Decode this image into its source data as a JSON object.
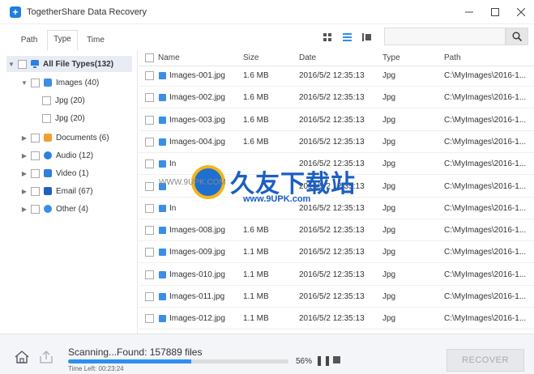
{
  "window": {
    "title": "TogetherShare Data Recovery",
    "controls": [
      "minimize",
      "maximize",
      "close"
    ]
  },
  "tabs": [
    {
      "label": "Path",
      "active": false
    },
    {
      "label": "Type",
      "active": true
    },
    {
      "label": "Time",
      "active": false
    }
  ],
  "search": {
    "placeholder": ""
  },
  "tree": {
    "root": {
      "label": "All File Types(132)"
    },
    "items": [
      {
        "label": "Images (40)",
        "expanded": true,
        "color": "#3a8ee6"
      },
      {
        "label": "Jpg (20)",
        "child": true
      },
      {
        "label": "Jpg (20)",
        "child": true
      },
      {
        "label": "Documents (6)",
        "color": "#f0a030"
      },
      {
        "label": "Audio (12)",
        "color": "#2d7fe0"
      },
      {
        "label": "Video (1)",
        "color": "#2d7fe0"
      },
      {
        "label": "Email (67)",
        "color": "#2060c0"
      },
      {
        "label": "Other (4)",
        "color": "#3a8ee6"
      }
    ]
  },
  "list": {
    "headers": {
      "name": "Name",
      "size": "Size",
      "date": "Date",
      "type": "Type",
      "path": "Path"
    },
    "rows": [
      {
        "name": "Images-001.jpg",
        "size": "1.6 MB",
        "date": "2016/5/2 12:35:13",
        "type": "Jpg",
        "path": "C:\\MyImages\\2016-1..."
      },
      {
        "name": "Images-002.jpg",
        "size": "1.6 MB",
        "date": "2016/5/2 12:35:13",
        "type": "Jpg",
        "path": "C:\\MyImages\\2016-1..."
      },
      {
        "name": "Images-003.jpg",
        "size": "1.6 MB",
        "date": "2016/5/2 12:35:13",
        "type": "Jpg",
        "path": "C:\\MyImages\\2016-1..."
      },
      {
        "name": "Images-004.jpg",
        "size": "1.6 MB",
        "date": "2016/5/2 12:35:13",
        "type": "Jpg",
        "path": "C:\\MyImages\\2016-1..."
      },
      {
        "name": "In",
        "size": "",
        "date": "2016/5/2 12:35:13",
        "type": "Jpg",
        "path": "C:\\MyImages\\2016-1..."
      },
      {
        "name": "",
        "size": "",
        "date": "2016/5/2 12:35:13",
        "type": "Jpg",
        "path": "C:\\MyImages\\2016-1..."
      },
      {
        "name": "In",
        "size": "",
        "date": "2016/5/2 12:35:13",
        "type": "Jpg",
        "path": "C:\\MyImages\\2016-1..."
      },
      {
        "name": "Images-008.jpg",
        "size": "1.6 MB",
        "date": "2016/5/2 12:35:13",
        "type": "Jpg",
        "path": "C:\\MyImages\\2016-1..."
      },
      {
        "name": "Images-009.jpg",
        "size": "1.1 MB",
        "date": "2016/5/2 12:35:13",
        "type": "Jpg",
        "path": "C:\\MyImages\\2016-1..."
      },
      {
        "name": "Images-010.jpg",
        "size": "1.1 MB",
        "date": "2016/5/2 12:35:13",
        "type": "Jpg",
        "path": "C:\\MyImages\\2016-1..."
      },
      {
        "name": "Images-011.jpg",
        "size": "1.1 MB",
        "date": "2016/5/2 12:35:13",
        "type": "Jpg",
        "path": "C:\\MyImages\\2016-1..."
      },
      {
        "name": "Images-012.jpg",
        "size": "1.1 MB",
        "date": "2016/5/2 12:35:13",
        "type": "Jpg",
        "path": "C:\\MyImages\\2016-1..."
      }
    ]
  },
  "watermark": {
    "brand": "久友下载站",
    "url": "www.9UPK.com",
    "url_small": "WWW.9UPK.COM"
  },
  "status": {
    "scan_text": "Scanning...Found: 157889 files",
    "progress_percent": 56,
    "progress_label": "56%",
    "time_left": "Time Left: 00:23:24",
    "recover_label": "RECOVER"
  },
  "colors": {
    "accent": "#2d8ff0",
    "file_icon": "#3a8ee6"
  }
}
